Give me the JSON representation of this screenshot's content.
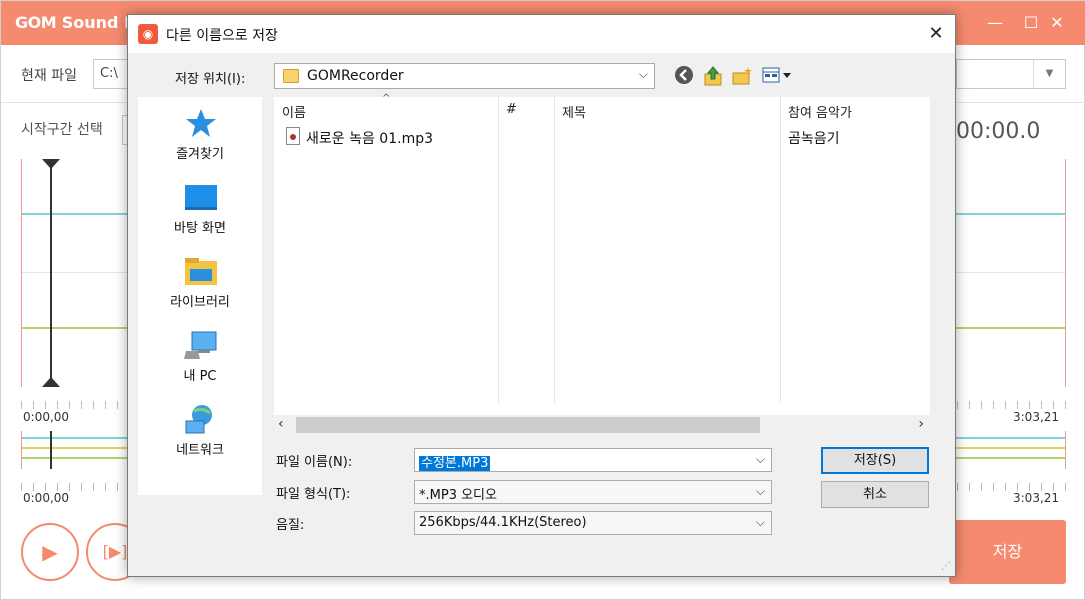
{
  "app": {
    "title_logo": "GOM",
    "title_rest": " Sound E",
    "window_min": "—",
    "window_max": "☐",
    "window_close": "✕",
    "current_file_label": "현재 파일",
    "current_file_value": "C:\\",
    "start_section_label": "시작구간 선택",
    "time_display": "00:00.0",
    "time_start": "0:00,00",
    "time_end": "3:03,21",
    "time_start2": "0:00,00",
    "time_end2": "3:03,21",
    "save_button": "저장",
    "colors": {
      "accent": "#f58a6f",
      "wave_cyan": "#7fd3d6",
      "wave_green": "#b5d36a",
      "wave_yellow": "#e8d25a"
    }
  },
  "dialog": {
    "title": "다른 이름으로 저장",
    "close_glyph": "✕",
    "save_in_label": "저장 위치(I):",
    "save_in_value": "GOMRecorder",
    "places": [
      {
        "label": "즐겨찾기",
        "icon": "star-icon"
      },
      {
        "label": "바탕 화면",
        "icon": "desktop-icon"
      },
      {
        "label": "라이브러리",
        "icon": "library-icon"
      },
      {
        "label": "내 PC",
        "icon": "computer-icon"
      },
      {
        "label": "네트워크",
        "icon": "network-icon"
      }
    ],
    "columns": [
      "이름",
      "#",
      "제목",
      "참여 음악가"
    ],
    "files": [
      {
        "name": "새로운 녹음 01.mp3",
        "number": "",
        "title": "",
        "artist": "곰녹음기"
      }
    ],
    "filename_label": "파일 이름(N):",
    "filename_value": "수정본.MP3",
    "filetype_label": "파일 형식(T):",
    "filetype_value": "*.MP3 오디오",
    "quality_label": "음질:",
    "quality_value": "256Kbps/44.1KHz(Stereo)",
    "save_button": "저장(S)",
    "cancel_button": "취소"
  }
}
